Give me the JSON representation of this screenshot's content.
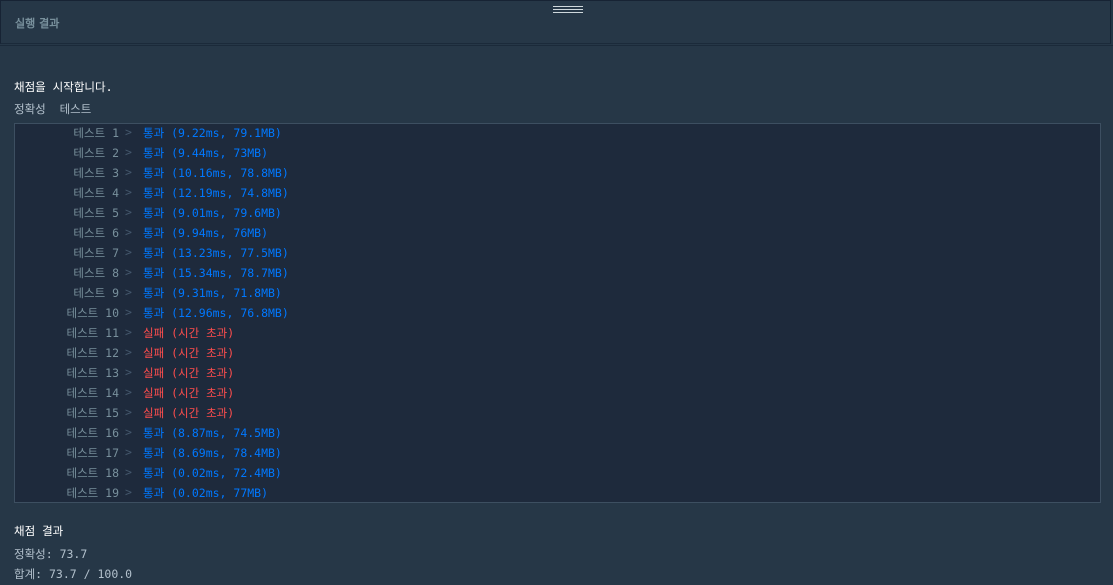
{
  "panel": {
    "title": "실행 결과"
  },
  "console": {
    "start_message": "채점을 시작합니다.",
    "section_title": "정확성  테스트",
    "tests": [
      {
        "label": "테스트 1",
        "status": "pass",
        "result": "통과 (9.22ms, 79.1MB)"
      },
      {
        "label": "테스트 2",
        "status": "pass",
        "result": "통과 (9.44ms, 73MB)"
      },
      {
        "label": "테스트 3",
        "status": "pass",
        "result": "통과 (10.16ms, 78.8MB)"
      },
      {
        "label": "테스트 4",
        "status": "pass",
        "result": "통과 (12.19ms, 74.8MB)"
      },
      {
        "label": "테스트 5",
        "status": "pass",
        "result": "통과 (9.01ms, 79.6MB)"
      },
      {
        "label": "테스트 6",
        "status": "pass",
        "result": "통과 (9.94ms, 76MB)"
      },
      {
        "label": "테스트 7",
        "status": "pass",
        "result": "통과 (13.23ms, 77.5MB)"
      },
      {
        "label": "테스트 8",
        "status": "pass",
        "result": "통과 (15.34ms, 78.7MB)"
      },
      {
        "label": "테스트 9",
        "status": "pass",
        "result": "통과 (9.31ms, 71.8MB)"
      },
      {
        "label": "테스트 10",
        "status": "pass",
        "result": "통과 (12.96ms, 76.8MB)"
      },
      {
        "label": "테스트 11",
        "status": "fail",
        "result": "실패 (시간 초과)"
      },
      {
        "label": "테스트 12",
        "status": "fail",
        "result": "실패 (시간 초과)"
      },
      {
        "label": "테스트 13",
        "status": "fail",
        "result": "실패 (시간 초과)"
      },
      {
        "label": "테스트 14",
        "status": "fail",
        "result": "실패 (시간 초과)"
      },
      {
        "label": "테스트 15",
        "status": "fail",
        "result": "실패 (시간 초과)"
      },
      {
        "label": "테스트 16",
        "status": "pass",
        "result": "통과 (8.87ms, 74.5MB)"
      },
      {
        "label": "테스트 17",
        "status": "pass",
        "result": "통과 (8.69ms, 78.4MB)"
      },
      {
        "label": "테스트 18",
        "status": "pass",
        "result": "통과 (0.02ms, 72.4MB)"
      },
      {
        "label": "테스트 19",
        "status": "pass",
        "result": "통과 (0.02ms, 77MB)"
      }
    ],
    "arrow_glyph": ">",
    "final_title": "채점 결과",
    "accuracy": "정확성: 73.7",
    "total": "합계: 73.7 / 100.0"
  },
  "colors": {
    "background": "#263747",
    "box_background": "#1e2a3c",
    "pass": "#0078ff",
    "fail": "#ff4d4d",
    "muted": "#78909c"
  }
}
